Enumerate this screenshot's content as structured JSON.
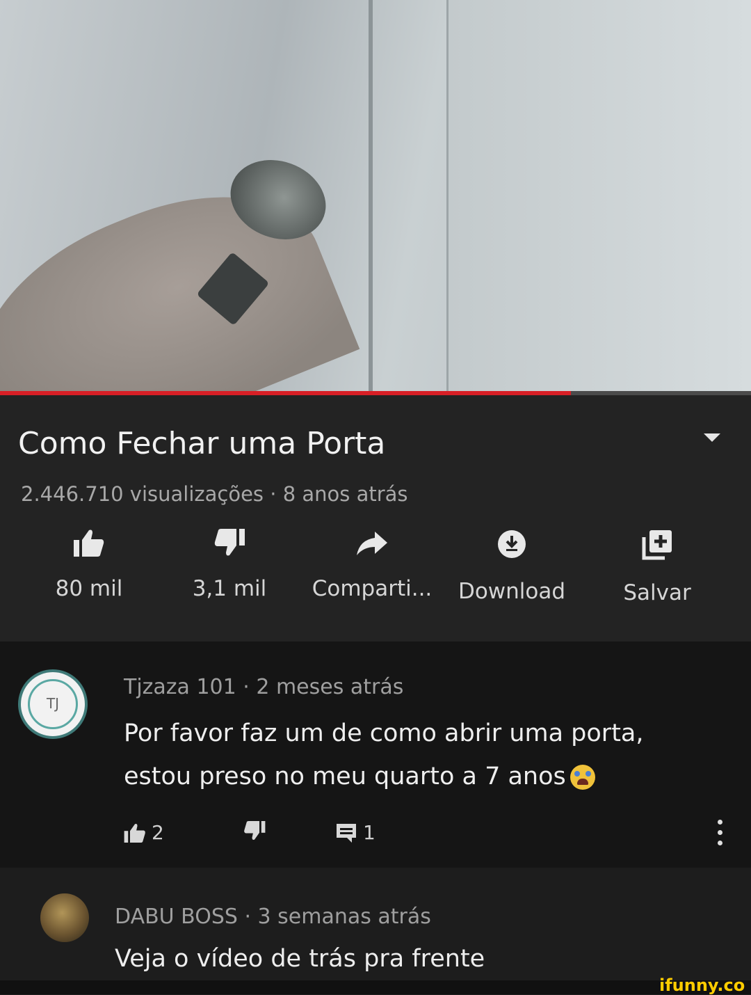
{
  "video": {
    "progress_fraction": 0.76
  },
  "info": {
    "title": "Como Fechar uma Porta",
    "meta": "2.446.710 visualizações · 8 anos atrás"
  },
  "actions": {
    "like_count": "80 mil",
    "dislike_count": "3,1 mil",
    "share_label": "Comparti...",
    "download_label": "Download",
    "save_label": "Salvar"
  },
  "comments": [
    {
      "avatar_text": "TJ",
      "author_line": "Tjzaza 101 · 2 meses atrás",
      "text_line1": "Por favor faz um de como abrir uma porta,",
      "text_line2": "estou preso no meu quarto a 7 anos",
      "emoji": "loudly-crying-face",
      "likes": "2",
      "replies": "1"
    },
    {
      "author_line": "DABU BOSS · 3 semanas atrás",
      "text_line1": "Veja o vídeo de trás pra frente"
    }
  ],
  "watermark": "ifunny.co",
  "colors": {
    "progress": "#d81f26",
    "background": "#232323",
    "comment_bg": "#151515",
    "watermark": "#ffcc00"
  }
}
